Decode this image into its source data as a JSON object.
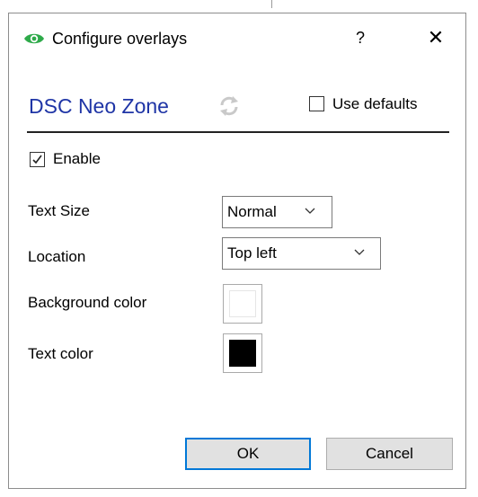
{
  "dialog": {
    "title": "Configure overlays",
    "help_label": "?",
    "close_label": "✕",
    "accent_color": "#1f35a6",
    "icon_color": "#2eaa4a"
  },
  "header": {
    "heading": "DSC Neo Zone",
    "use_defaults_label": "Use defaults",
    "use_defaults_checked": false
  },
  "enable": {
    "label": "Enable",
    "checked": true
  },
  "fields": {
    "text_size": {
      "label": "Text Size",
      "value": "Normal"
    },
    "location": {
      "label": "Location",
      "value": "Top left"
    },
    "background_color": {
      "label": "Background color",
      "value": "#ffffff"
    },
    "text_color": {
      "label": "Text color",
      "value": "#000000"
    }
  },
  "buttons": {
    "ok_label": "OK",
    "cancel_label": "Cancel"
  }
}
